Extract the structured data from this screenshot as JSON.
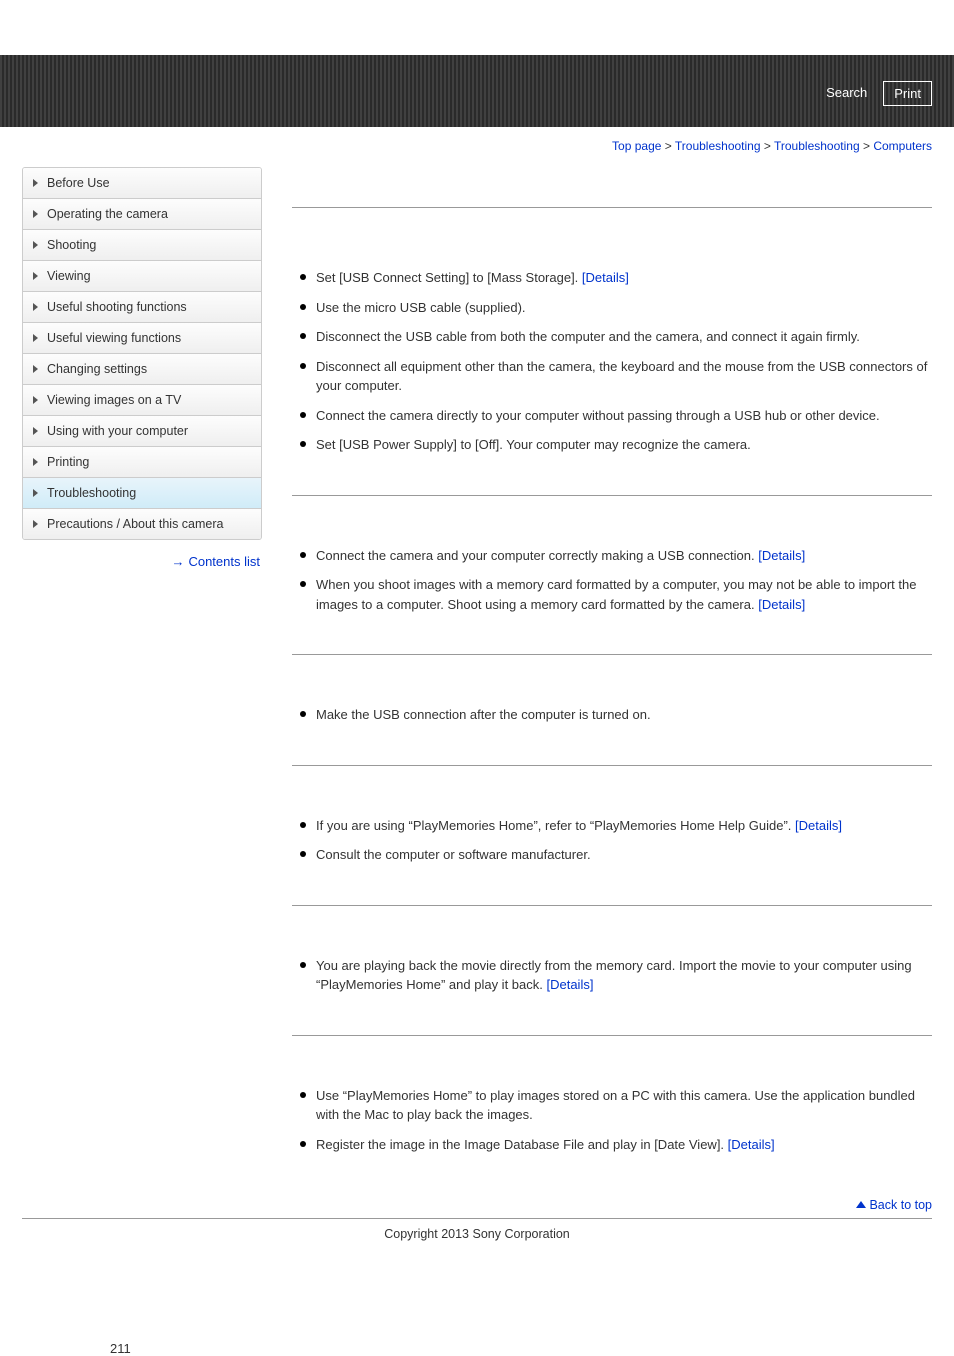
{
  "header": {
    "search_label": "Search",
    "print_label": "Print"
  },
  "breadcrumb": {
    "items": [
      {
        "text": "Top page",
        "link": true
      },
      {
        "text": "Troubleshooting",
        "link": true
      },
      {
        "text": "Troubleshooting",
        "link": true
      },
      {
        "text": "Computers",
        "link": true
      }
    ],
    "sep": " > "
  },
  "sidebar": {
    "items": [
      {
        "label": "Before Use"
      },
      {
        "label": "Operating the camera"
      },
      {
        "label": "Shooting"
      },
      {
        "label": "Viewing"
      },
      {
        "label": "Useful shooting functions"
      },
      {
        "label": "Useful viewing functions"
      },
      {
        "label": "Changing settings"
      },
      {
        "label": "Viewing images on a TV"
      },
      {
        "label": "Using with your computer"
      },
      {
        "label": "Printing"
      },
      {
        "label": "Troubleshooting",
        "active": true
      },
      {
        "label": "Precautions / About this camera"
      }
    ],
    "contents_link": "Contents list"
  },
  "sections": [
    {
      "items": [
        {
          "text": "Set [USB Connect Setting] to [Mass Storage]. ",
          "link": "[Details]"
        },
        {
          "text": "Use the micro USB cable (supplied)."
        },
        {
          "text": "Disconnect the USB cable from both the computer and the camera, and connect it again firmly."
        },
        {
          "text": "Disconnect all equipment other than the camera, the keyboard and the mouse from the USB connectors of your computer."
        },
        {
          "text": "Connect the camera directly to your computer without passing through a USB hub or other device."
        },
        {
          "text": "Set [USB Power Supply] to [Off]. Your computer may recognize the camera."
        }
      ]
    },
    {
      "items": [
        {
          "text": "Connect the camera and your computer correctly making a USB connection. ",
          "link": "[Details]"
        },
        {
          "text": "When you shoot images with a memory card formatted by a computer, you may not be able to import the images to a computer. Shoot using a memory card formatted by the camera. ",
          "link": "[Details]"
        }
      ]
    },
    {
      "items": [
        {
          "text": "Make the USB connection after the computer is turned on."
        }
      ]
    },
    {
      "items": [
        {
          "text": "If you are using “PlayMemories Home”, refer to “PlayMemories Home Help Guide”. ",
          "link": "[Details]"
        },
        {
          "text": "Consult the computer or software manufacturer."
        }
      ]
    },
    {
      "items": [
        {
          "text": "You are playing back the movie directly from the memory card. Import the movie to your computer using “PlayMemories Home” and play it back. ",
          "link": "[Details]"
        }
      ]
    },
    {
      "items": [
        {
          "text": "Use “PlayMemories Home” to play images stored on a PC with this camera. Use the application bundled with the Mac to play back the images."
        },
        {
          "text": "Register the image in the Image Database File and play in [Date View]. ",
          "link": "[Details]"
        }
      ]
    }
  ],
  "back_to_top": "Back to top",
  "copyright": "Copyright 2013 Sony Corporation",
  "page_number": "211"
}
